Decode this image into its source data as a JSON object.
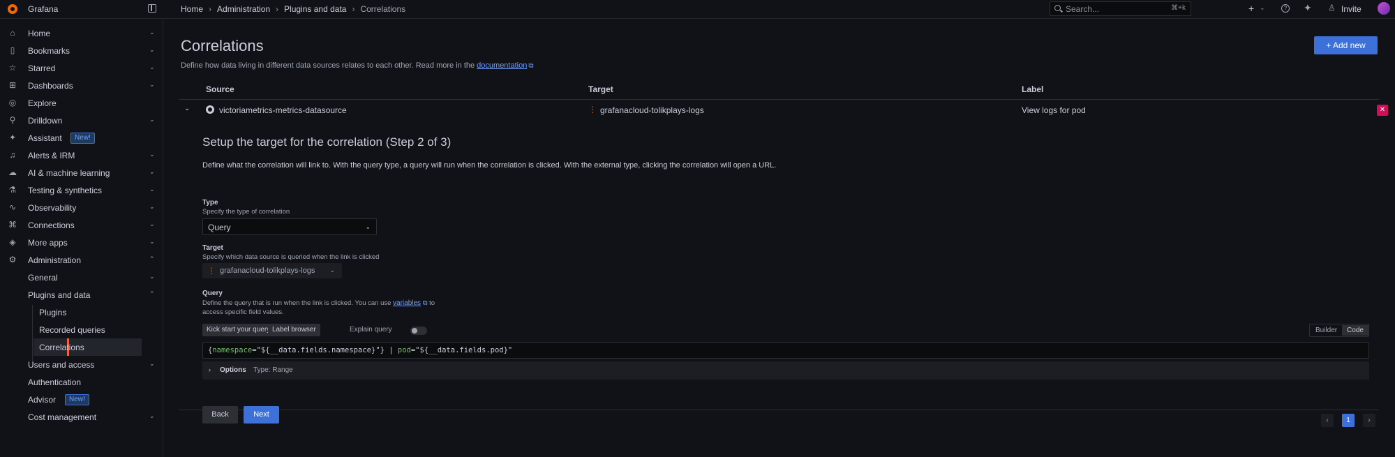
{
  "app": {
    "brand": "Grafana"
  },
  "breadcrumbs": [
    "Home",
    "Administration",
    "Plugins and data",
    "Correlations"
  ],
  "search": {
    "placeholder": "Search...",
    "shortcut": "⌘+k"
  },
  "topbar": {
    "invite_label": "Invite"
  },
  "sidebar": {
    "items": [
      {
        "label": "Home",
        "icon": "home-icon"
      },
      {
        "label": "Bookmarks",
        "icon": "bookmark-icon"
      },
      {
        "label": "Starred",
        "icon": "star-icon"
      },
      {
        "label": "Dashboards",
        "icon": "apps-icon"
      },
      {
        "label": "Explore",
        "icon": "compass-icon"
      },
      {
        "label": "Drilldown",
        "icon": "drilldown-icon"
      },
      {
        "label": "Assistant",
        "icon": "sparkle-icon",
        "badge": "New!"
      },
      {
        "label": "Alerts & IRM",
        "icon": "bell-icon"
      },
      {
        "label": "AI & machine learning",
        "icon": "brain-icon"
      },
      {
        "label": "Testing & synthetics",
        "icon": "testing-icon"
      },
      {
        "label": "Observability",
        "icon": "pulse-icon"
      },
      {
        "label": "Connections",
        "icon": "plug-icon"
      },
      {
        "label": "More apps",
        "icon": "cube-icon"
      },
      {
        "label": "Administration",
        "icon": "cog-icon"
      }
    ],
    "admin_children": [
      {
        "label": "General"
      },
      {
        "label": "Plugins and data"
      }
    ],
    "plugins_children": [
      {
        "label": "Plugins"
      },
      {
        "label": "Recorded queries"
      },
      {
        "label": "Correlations"
      }
    ],
    "admin_rest": [
      {
        "label": "Users and access"
      },
      {
        "label": "Authentication"
      },
      {
        "label": "Advisor",
        "badge": "New!"
      },
      {
        "label": "Cost management"
      }
    ]
  },
  "page": {
    "title": "Correlations",
    "subtitle": "Define how data living in different data sources relates to each other. Read more in the",
    "doc_link": "documentation",
    "add_button": "Add new"
  },
  "table": {
    "headers": [
      "Source",
      "Target",
      "Label"
    ],
    "row": {
      "source": "victoriametrics-metrics-datasource",
      "target": "grafanacloud-tolikplays-logs",
      "label": "View logs for pod"
    }
  },
  "form": {
    "step_title": "Setup the target for the correlation (Step 2 of 3)",
    "step_description": "Define what the correlation will link to. With the query type, a query will run when the correlation is clicked. With the external type, clicking the correlation will open a URL.",
    "type_label": "Type",
    "type_desc": "Specify the type of correlation",
    "type_value": "Query",
    "target_label": "Target",
    "target_desc": "Specify which data source is queried when the link is clicked",
    "target_value": "grafanacloud-tolikplays-logs",
    "query_label": "Query",
    "query_desc_1": "Define the query that is run when the link is clicked. You can use",
    "query_desc_link": "variables",
    "query_desc_2": "to",
    "query_desc_3": "access specific field values.",
    "kickstart_button": "Kick start your query",
    "label_browser_button": "Label browser",
    "explain_label": "Explain query",
    "mode_builder": "Builder",
    "mode_code": "Code",
    "query_open": "{",
    "query_key": "namespace",
    "query_eq": "=",
    "query_val": "\"${__data.fields.namespace}\"",
    "query_close": "} | ",
    "query_key2": "pod",
    "query_val2": "\"${__data.fields.pod}\"",
    "options_label": "Options",
    "options_desc": "Type: Range",
    "back_button": "Back",
    "next_button": "Next"
  },
  "pagination": {
    "current": "1"
  },
  "colors": {
    "accent": "#3d71d9",
    "danger": "#d10e5c",
    "brand": "#f46800",
    "active_marker": "#f55f3e"
  }
}
